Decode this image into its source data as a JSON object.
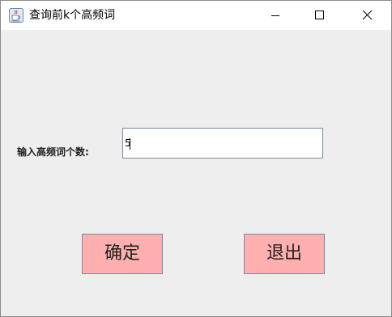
{
  "window": {
    "title": "查询前k个高频词",
    "app_icon": "java-cup-icon",
    "controls": [
      "minimize-icon",
      "maximize-icon",
      "close-icon"
    ]
  },
  "form": {
    "label": "输入高频词个数:",
    "input_value": "5"
  },
  "buttons": {
    "confirm_label": "确定",
    "exit_label": "退出"
  },
  "colors": {
    "button_bg": "#ffafaf",
    "content_bg": "#eeeeee",
    "titlebar_bg": "#ffffff"
  }
}
